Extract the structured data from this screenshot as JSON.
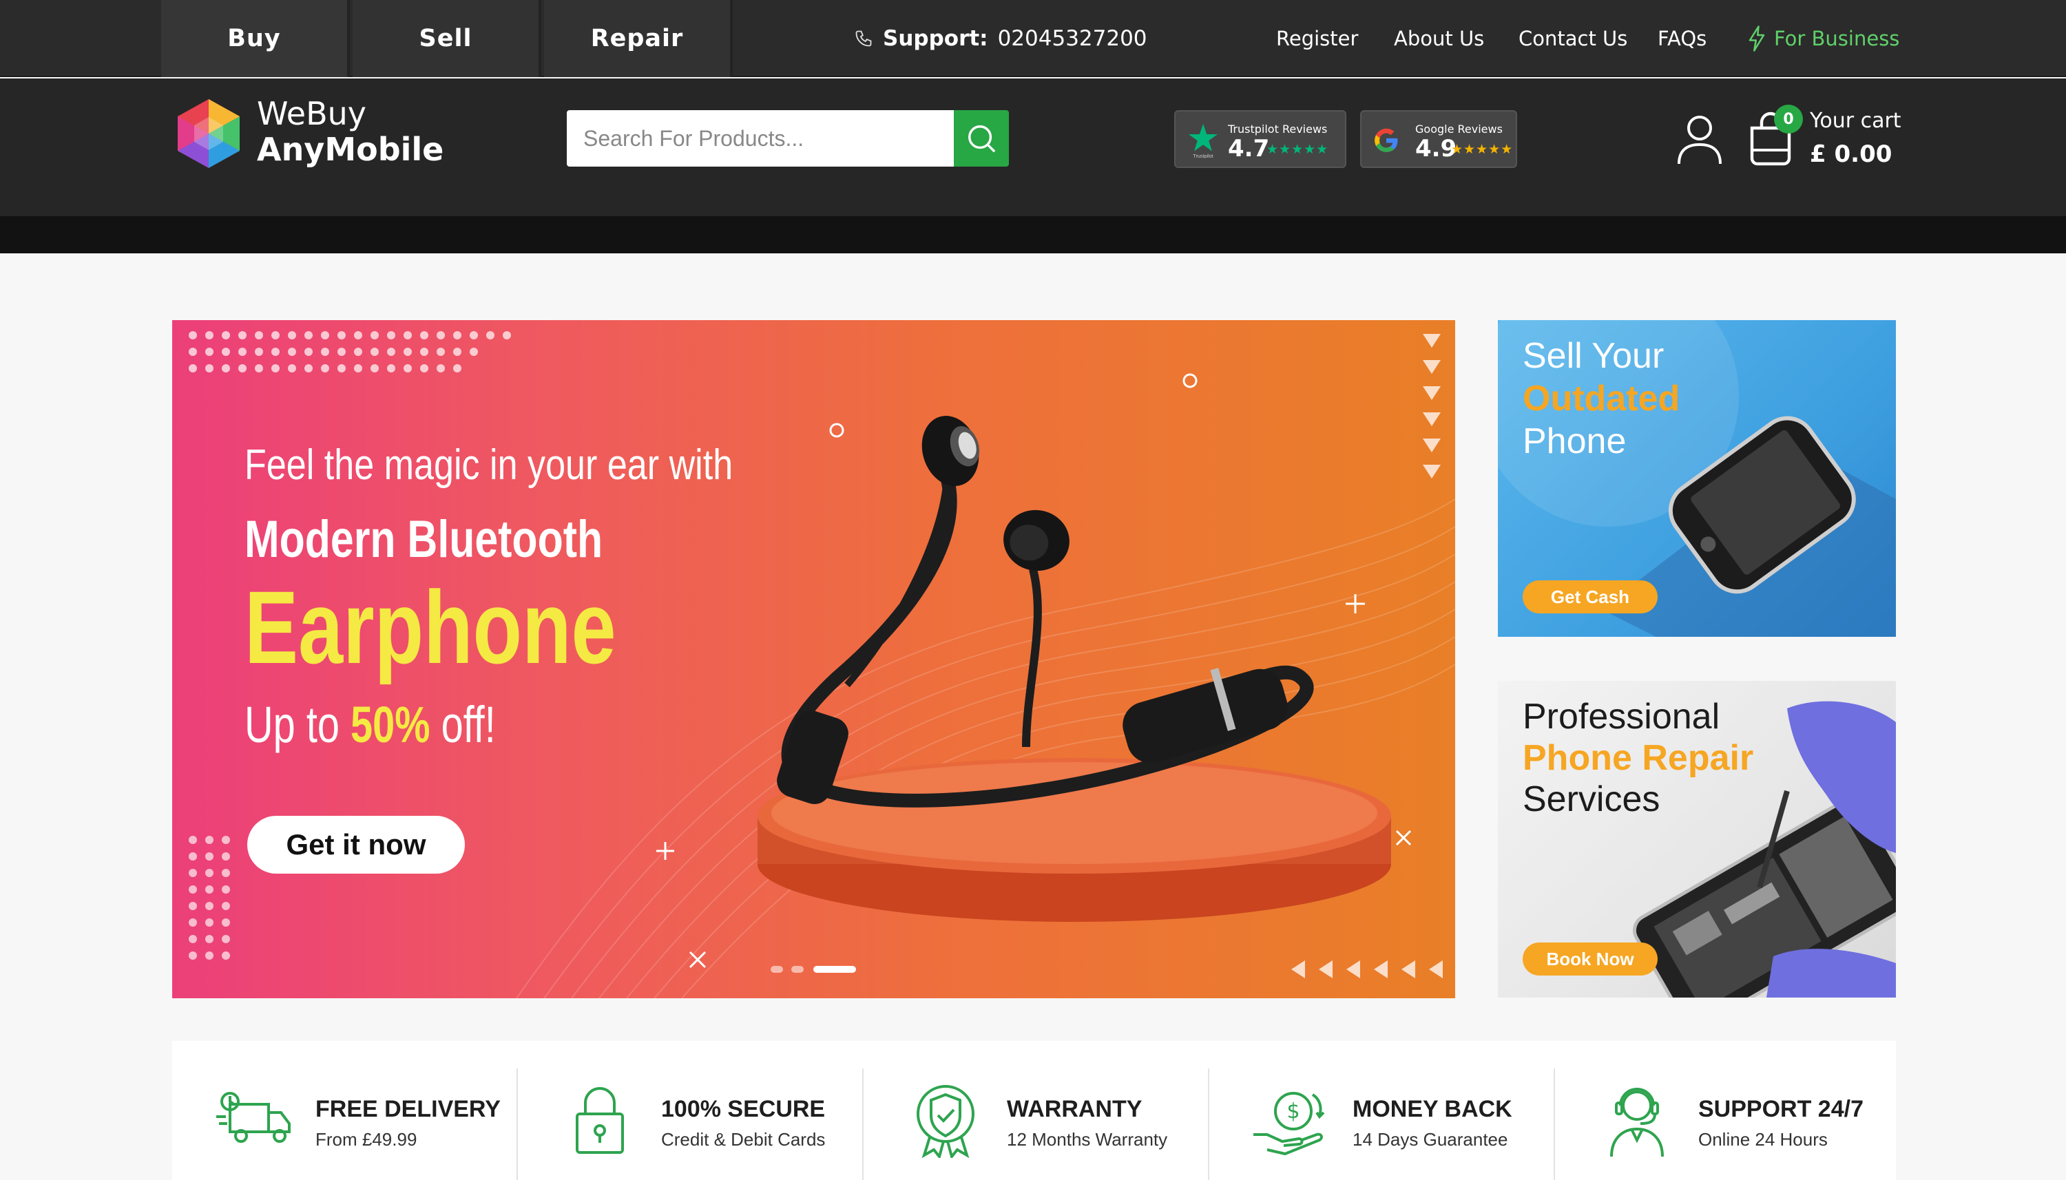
{
  "topbar": {
    "tabs": [
      {
        "label": "Buy"
      },
      {
        "label": "Sell"
      },
      {
        "label": "Repair"
      }
    ],
    "support_label": "Support:",
    "support_phone": "02045327200",
    "links": [
      {
        "label": "Register"
      },
      {
        "label": "About Us"
      },
      {
        "label": "Contact Us"
      },
      {
        "label": "FAQs"
      }
    ],
    "business_label": "For Business"
  },
  "header": {
    "logo_line1": "WeBuy",
    "logo_line2": "AnyMobile",
    "search_placeholder": "Search For Products...",
    "reviews": [
      {
        "label": "Trustpilot Reviews",
        "score": "4.7",
        "icon": "trustpilot-star-icon"
      },
      {
        "label": "Google Reviews",
        "score": "4.9",
        "icon": "google-g-icon"
      }
    ],
    "cart": {
      "count": "0",
      "label": "Your cart",
      "total": "£ 0.00"
    }
  },
  "hero": {
    "line1": "Feel the magic in your ear with",
    "line2": "Modern Bluetooth",
    "line3": "Earphone",
    "offer_prefix": "Up to ",
    "offer_highlight": "50%",
    "offer_suffix": " off!",
    "cta": "Get it now",
    "slides_total": 3,
    "slide_active": 3
  },
  "promos": [
    {
      "line1": "Sell Your",
      "line2": "Outdated",
      "line3": "Phone",
      "button": "Get Cash"
    },
    {
      "line1": "Professional",
      "line2": "Phone Repair",
      "line3": "Services",
      "button": "Book Now"
    }
  ],
  "features": [
    {
      "title": "FREE DELIVERY",
      "subtitle": "From £49.99",
      "icon": "delivery-truck-icon"
    },
    {
      "title": "100% SECURE",
      "subtitle": "Credit & Debit Cards",
      "icon": "padlock-icon"
    },
    {
      "title": "WARRANTY",
      "subtitle": "12 Months Warranty",
      "icon": "warranty-badge-icon"
    },
    {
      "title": "MONEY BACK",
      "subtitle": "14 Days Guarantee",
      "icon": "money-back-icon"
    },
    {
      "title": "SUPPORT 24/7",
      "subtitle": "Online 24 Hours",
      "icon": "support-agent-icon"
    }
  ],
  "colors": {
    "accent_green": "#28a745",
    "hero_yellow": "#f5ea43",
    "promo_orange": "#f6a623",
    "topbar": "#2b2b2b"
  }
}
